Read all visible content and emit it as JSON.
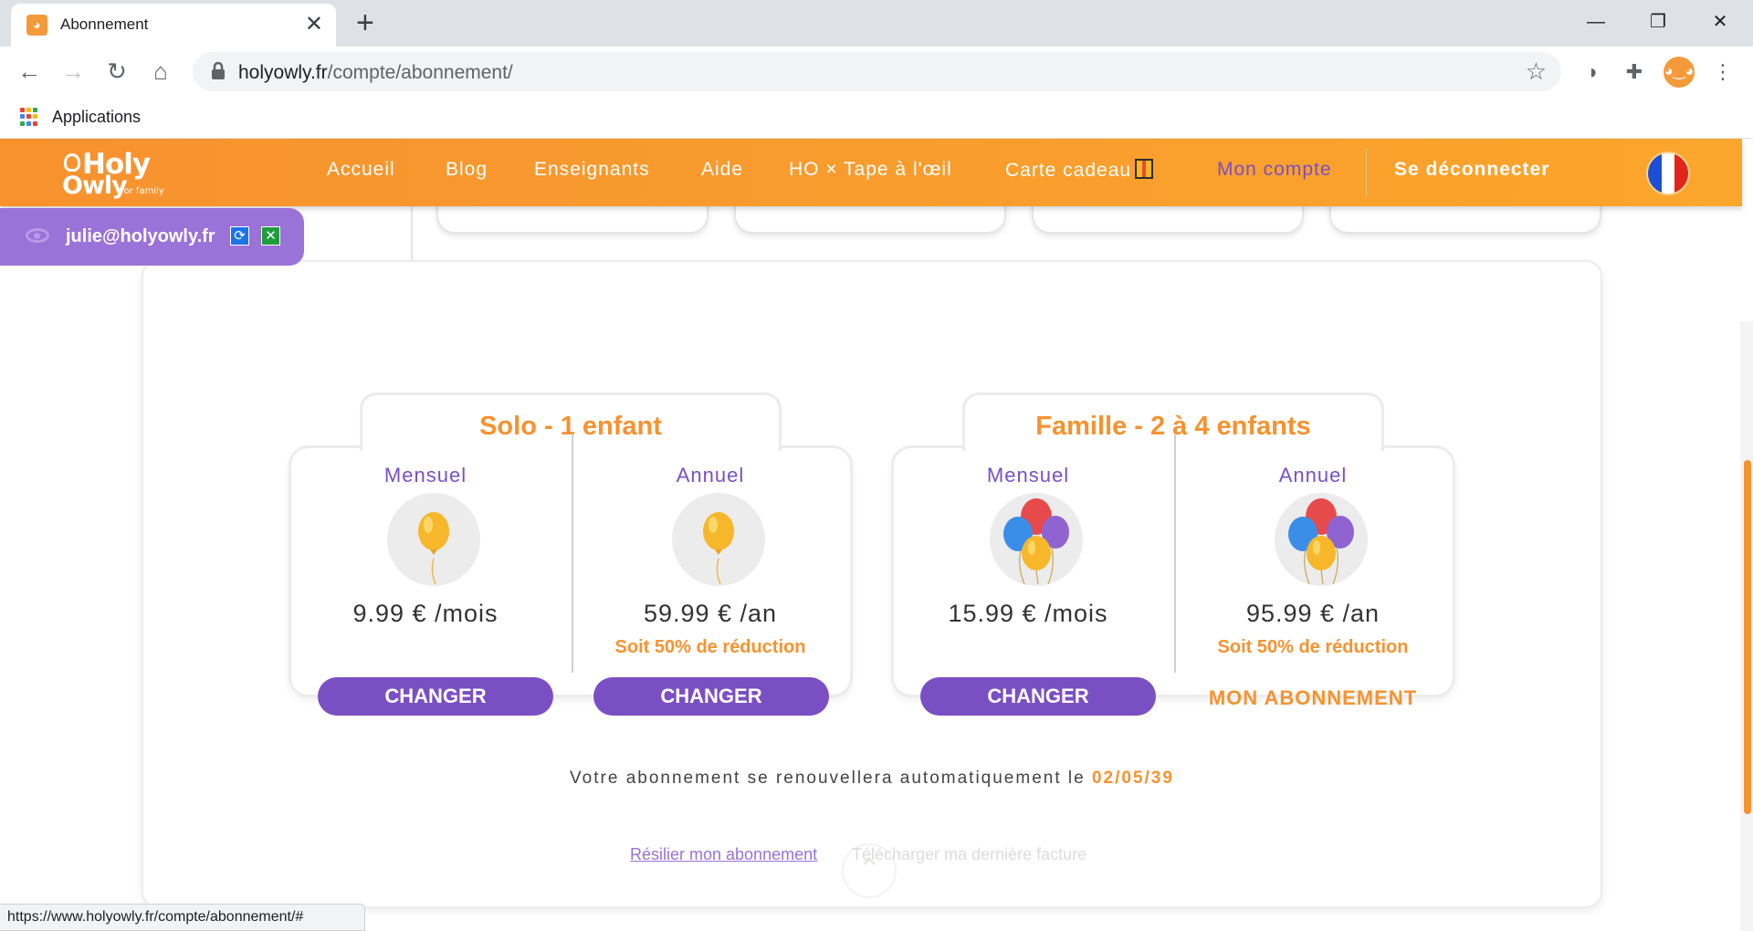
{
  "browser": {
    "tab_title": "Abonnement",
    "url_domain": "holyowly.fr",
    "url_path": "/compte/abonnement/",
    "bookmark_apps_label": "Applications",
    "status_url": "https://www.holyowly.fr/compte/abonnement/#"
  },
  "header": {
    "logo_line1": "Holy",
    "logo_line2": "Owly",
    "logo_tagline": "for family",
    "nav": [
      "Accueil",
      "Blog",
      "Enseignants",
      "Aide",
      "HO × Tape à l'œil",
      "Carte cadeau",
      "Mon compte",
      "Se déconnecter"
    ]
  },
  "user_badge": {
    "email": "julie@holyowly.fr"
  },
  "plans": [
    {
      "title": "Solo - 1 enfant",
      "monthly": {
        "label": "Mensuel",
        "price": "9.99 € /mois",
        "action": "CHANGER"
      },
      "yearly": {
        "label": "Annuel",
        "price": "59.99 € /an",
        "reduction": "Soit 50% de réduction",
        "action": "CHANGER"
      }
    },
    {
      "title": "Famille - 2 à 4 enfants",
      "monthly": {
        "label": "Mensuel",
        "price": "15.99 € /mois",
        "action": "CHANGER"
      },
      "yearly": {
        "label": "Annuel",
        "price": "95.99 € /an",
        "reduction": "Soit 50% de réduction",
        "current": "MON ABONNEMENT"
      }
    }
  ],
  "renewal": {
    "text": "Votre abonnement se renouvellera automatiquement le",
    "date": "02/05/39"
  },
  "links": {
    "cancel": "Résilier mon abonnement",
    "invoice": "Télécharger ma dernière facture"
  },
  "colors": {
    "brand_orange": "#f7922f",
    "brand_purple": "#7b4fc4"
  }
}
